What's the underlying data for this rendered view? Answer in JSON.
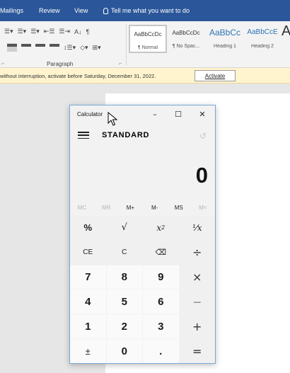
{
  "ribbon_tabs": {
    "items": [
      "Mailings",
      "Review",
      "View"
    ],
    "tell_me": "Tell me what you want to do"
  },
  "ribbon": {
    "paragraph_label": "Paragraph",
    "styles": [
      {
        "sample": "AaBbCcDc",
        "name": "¶ Normal"
      },
      {
        "sample": "AaBbCcDc",
        "name": "¶ No Spac..."
      },
      {
        "sample": "AaBbCc",
        "name": "Heading 1"
      },
      {
        "sample": "AaBbCcE",
        "name": "Heading 2"
      },
      {
        "sample": "A",
        "name": ""
      }
    ]
  },
  "message_bar": {
    "text": "without interruption, activate before Saturday, December 31, 2022.",
    "button": "Activate"
  },
  "calculator": {
    "window_title": "Calculator",
    "minimize": "–",
    "maximize": "☐",
    "close": "✕",
    "mode": "STANDARD",
    "history_icon": "↺",
    "display_value": "0",
    "memory": [
      "MC",
      "MR",
      "M+",
      "M-",
      "MS",
      "M˅"
    ],
    "keys": {
      "percent": "%",
      "sqrt": "√",
      "square": "x",
      "square_sup": "2",
      "reciprocal": "¹⁄x",
      "ce": "CE",
      "c": "C",
      "backspace": "⌫",
      "divide": "÷",
      "seven": "7",
      "eight": "8",
      "nine": "9",
      "multiply": "×",
      "four": "4",
      "five": "5",
      "six": "6",
      "minus": "—",
      "one": "1",
      "two": "2",
      "three": "3",
      "plus": "+",
      "negate": "±",
      "zero": "0",
      "decimal": ".",
      "equals": "="
    }
  }
}
